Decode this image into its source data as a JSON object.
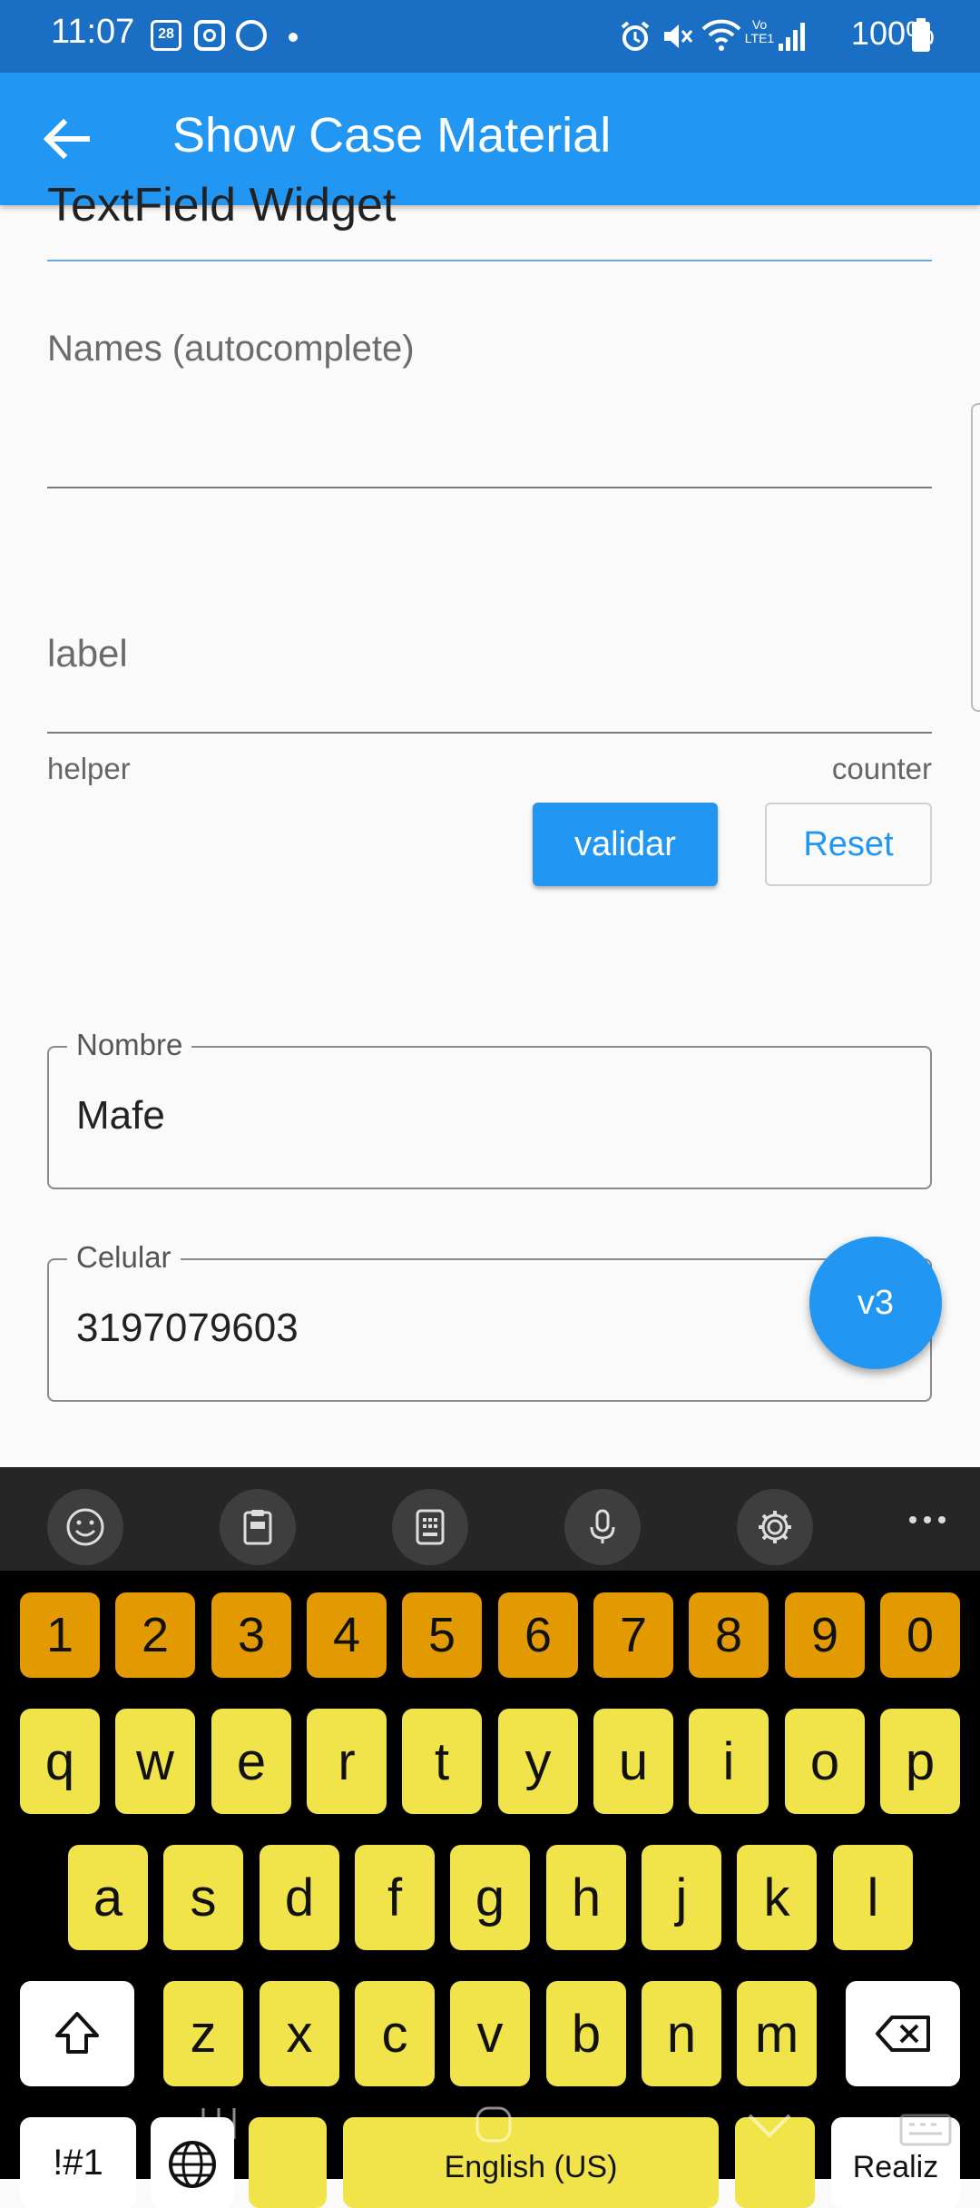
{
  "status_bar": {
    "time": "11:07",
    "calendar_day": "28",
    "battery": "100%",
    "volte": "Vo LTE1"
  },
  "app_bar": {
    "title": "Show Case Material"
  },
  "content": {
    "heading": "TextField Widget",
    "names_label": "Names (autocomplete)",
    "label_field": "label",
    "helper": "helper",
    "counter": "counter",
    "validar_button": "validar",
    "reset_button": "Reset",
    "nombre": {
      "label": "Nombre",
      "value": "Mafe"
    },
    "celular": {
      "label": "Celular",
      "value": "3197079603"
    },
    "fab": "v3"
  },
  "keyboard": {
    "numbers": [
      "1",
      "2",
      "3",
      "4",
      "5",
      "6",
      "7",
      "8",
      "9",
      "0"
    ],
    "row1": [
      "q",
      "w",
      "e",
      "r",
      "t",
      "y",
      "u",
      "i",
      "o",
      "p"
    ],
    "row2": [
      "a",
      "s",
      "d",
      "f",
      "g",
      "h",
      "j",
      "k",
      "l"
    ],
    "row3": [
      "z",
      "x",
      "c",
      "v",
      "b",
      "n",
      "m"
    ],
    "symbols_key": "!#1",
    "space_label": "English (US)",
    "action_key": "Realiz",
    "colors": {
      "number_keys": "#e39a00",
      "letter_keys": "#f0e44a",
      "background": "#000000"
    }
  },
  "colors": {
    "primary": "#2196f3",
    "status_bar": "#1a6fc4"
  }
}
